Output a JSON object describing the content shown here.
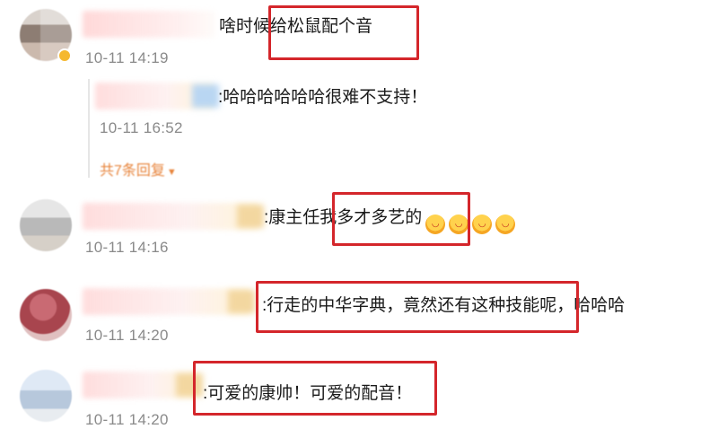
{
  "comments": [
    {
      "text": "啥时候给松鼠配个音",
      "time": "10-11 14:19",
      "replies": [
        {
          "text": ":哈哈哈哈哈哈很难不支持！",
          "time": "10-11 16:52"
        }
      ],
      "more_replies_label": "共7条回复"
    },
    {
      "text_prefix": ":康主任我",
      "text_highlight": "多才多艺的",
      "emoji_count": 4,
      "time": "10-11 14:16"
    },
    {
      "text_highlight": ":行走的中华字典，竟然还有这种技能呢，",
      "text_suffix": "哈哈哈",
      "time": "10-11 14:20"
    },
    {
      "text_highlight": ":可爱的康帅！可爱的配音！",
      "time": "10-11 14:20"
    }
  ],
  "colors": {
    "highlight_box": "#d4262b",
    "timestamp": "#8a8a8a",
    "more_replies": "#e7833a"
  },
  "icons": [
    "vip-badge-icon",
    "laughing-emoji-icon",
    "caret-down-icon"
  ]
}
